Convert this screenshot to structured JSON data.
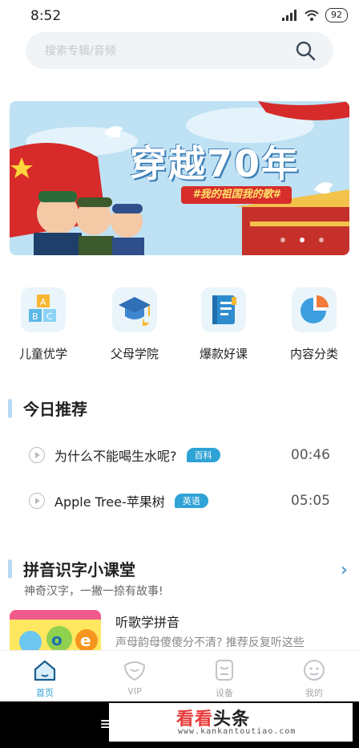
{
  "status": {
    "time": "8:52",
    "battery": "92"
  },
  "search": {
    "placeholder": "搜索专辑/音频"
  },
  "banner": {
    "title": "穿越70年",
    "subtitle": "#我的祖国我的歌#"
  },
  "categories": [
    {
      "label": "儿童优学",
      "icon": "abc-blocks-icon"
    },
    {
      "label": "父母学院",
      "icon": "graduation-cap-icon"
    },
    {
      "label": "爆款好课",
      "icon": "book-icon"
    },
    {
      "label": "内容分类",
      "icon": "pie-chart-icon"
    }
  ],
  "today": {
    "title": "今日推荐",
    "items": [
      {
        "title": "为什么不能喝生水呢?",
        "tag": "百科",
        "duration": "00:46"
      },
      {
        "title": "Apple Tree-苹果树",
        "tag": "英语",
        "duration": "05:05"
      }
    ]
  },
  "pinyin": {
    "title": "拼音识字小课堂",
    "subtitle": "神奇汉字，一撇一捺有故事!",
    "card": {
      "title": "听歌学拼音",
      "desc": "声母韵母傻傻分不清? 推荐反复听这些"
    }
  },
  "tabs": [
    {
      "label": "首页",
      "icon": "home-icon",
      "active": true
    },
    {
      "label": "VIP",
      "icon": "vip-icon",
      "active": false
    },
    {
      "label": "设备",
      "icon": "device-icon",
      "active": false
    },
    {
      "label": "我的",
      "icon": "profile-icon",
      "active": false
    }
  ],
  "watermark": {
    "logo_main": "看看",
    "logo_sub": "头条",
    "url": "www.kankantoutiao.com"
  },
  "colors": {
    "accent": "#2fa2d6",
    "banner_sky": "#bfe1f4",
    "tag_bg": "#2fa2d6"
  }
}
